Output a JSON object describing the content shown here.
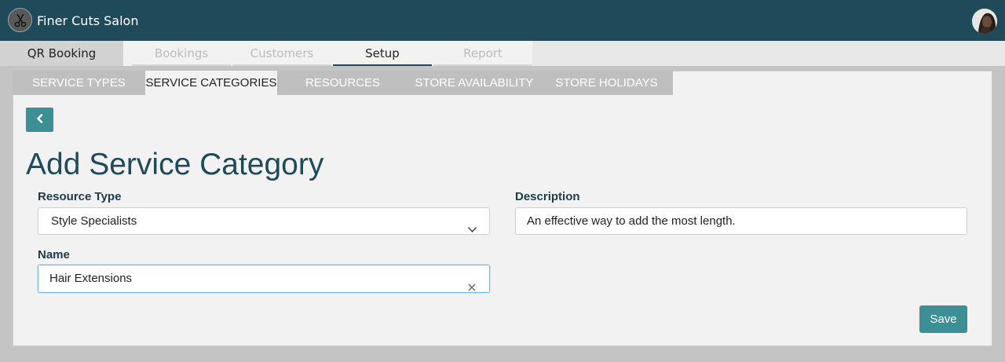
{
  "app": {
    "title": "Finer Cuts Salon"
  },
  "icons": {
    "logo": "scissors-icon",
    "back": "chevron-left-icon",
    "dropdown": "chevron-down-icon",
    "clear": "close-icon",
    "avatar": "user-avatar"
  },
  "colors": {
    "header_bg": "#1f4a5a",
    "accent": "#3d8f96",
    "title_text": "#1f4a5a"
  },
  "nav": {
    "home": "QR Booking",
    "tabs": [
      {
        "label": "Bookings",
        "state": "disabled"
      },
      {
        "label": "Customers",
        "state": "disabled"
      },
      {
        "label": "Setup",
        "state": "active"
      },
      {
        "label": "Report",
        "state": "disabled"
      }
    ]
  },
  "subtabs": [
    {
      "label": "SERVICE TYPES",
      "active": false
    },
    {
      "label": "SERVICE CATEGORIES",
      "active": true
    },
    {
      "label": "RESOURCES",
      "active": false
    },
    {
      "label": "STORE AVAILABILITY",
      "active": false
    },
    {
      "label": "STORE HOLIDAYS",
      "active": false
    }
  ],
  "form": {
    "title": "Add Service Category",
    "resource_type": {
      "label": "Resource Type",
      "value": "Style Specialists"
    },
    "description": {
      "label": "Description",
      "value": "An effective way to add the most length."
    },
    "name": {
      "label": "Name",
      "value": "Hair Extensions"
    },
    "save_label": "Save"
  }
}
